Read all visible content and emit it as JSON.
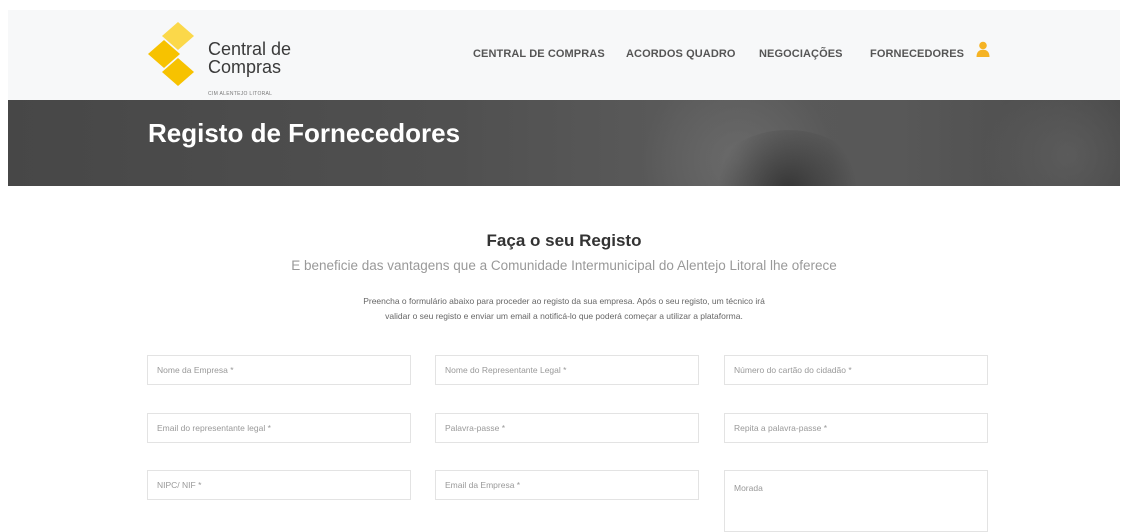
{
  "header": {
    "logo": {
      "line1": "Central de",
      "line2": "Compras",
      "subtitle": "CIM ALENTEJO LITORAL",
      "colors": {
        "primary": "#f7c200",
        "light": "#fbd84a"
      }
    },
    "nav": [
      {
        "label": "CENTRAL DE COMPRAS"
      },
      {
        "label": "ACORDOS QUADRO"
      },
      {
        "label": "NEGOCIAÇÕES"
      },
      {
        "label": "FORNECEDORES"
      }
    ],
    "user_icon": "user-icon",
    "accent_color": "#f5b324"
  },
  "banner": {
    "title": "Registo de Fornecedores"
  },
  "form": {
    "title": "Faça o seu Registo",
    "subtitle": "E beneficie das vantagens que a Comunidade Intermunicipal do Alentejo Litoral lhe oferece",
    "description_line1": "Preencha o formulário abaixo para proceder ao registo da sua empresa. Após o seu registo, um técnico irá",
    "description_line2": "validar o seu registo e enviar um email a notificá-lo que poderá começar a utilizar a plataforma.",
    "fields": {
      "company_name": "Nome da Empresa *",
      "legal_rep_name": "Nome do Representante Legal *",
      "citizen_card": "Número do cartão do cidadão *",
      "legal_rep_email": "Email do representante legal *",
      "password": "Palavra-passe *",
      "password_repeat": "Repita a palavra-passe *",
      "nipc_nif": "NIPC/ NIF *",
      "company_email": "Email da Empresa *",
      "address": "Morada"
    }
  }
}
